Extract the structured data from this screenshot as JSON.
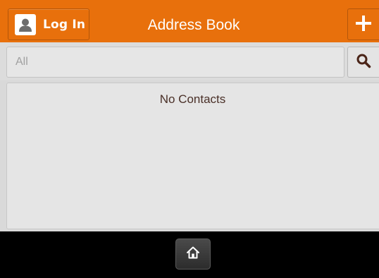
{
  "header": {
    "title": "Address Book",
    "login_label": "Log In",
    "login_icon": "user-icon",
    "add_icon": "plus-icon"
  },
  "search": {
    "placeholder": "All",
    "value": "",
    "icon": "search-icon"
  },
  "contacts": {
    "empty_message": "No Contacts",
    "items": []
  },
  "footer": {
    "home_icon": "home-icon"
  },
  "colors": {
    "accent": "#e8700c",
    "footer": "#000000",
    "panel": "#e5e5e5"
  }
}
